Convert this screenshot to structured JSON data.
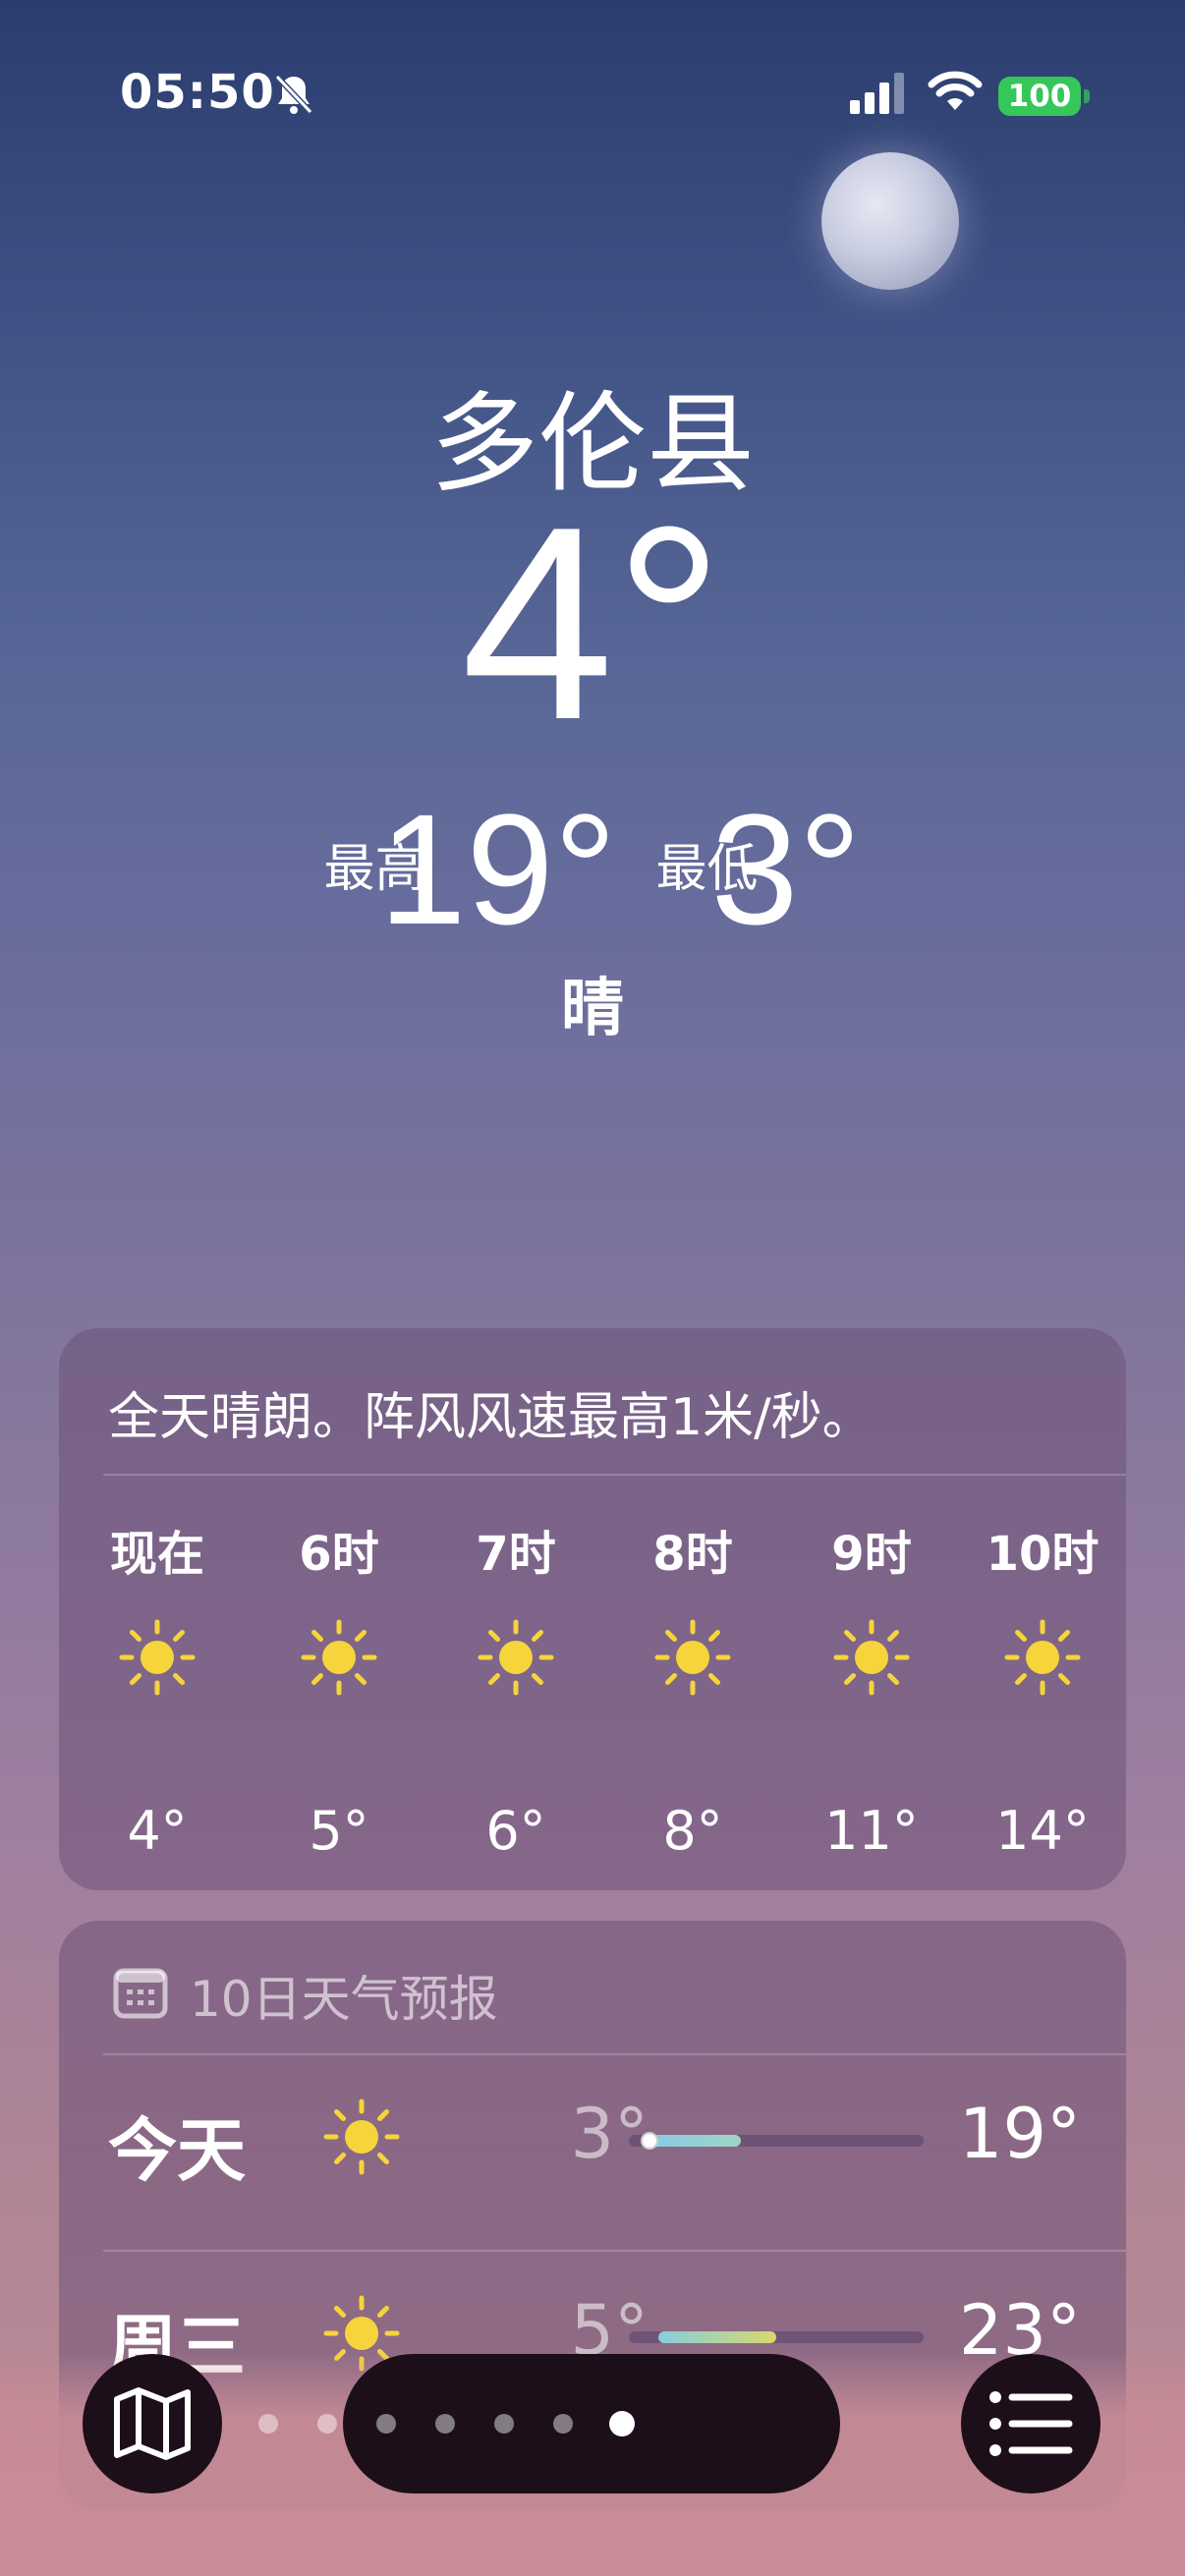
{
  "status_bar": {
    "time": "05:50",
    "battery": "100"
  },
  "location": {
    "city": "多伦县",
    "temperature": "4°",
    "high_label": "最高",
    "high": "19°",
    "low_label": "最低",
    "low": "3°",
    "condition": "晴"
  },
  "hourly": {
    "summary": "全天晴朗。阵风风速最高1米/秒。",
    "hours": [
      {
        "label": "现在",
        "icon": "sun-icon",
        "temp": "4°"
      },
      {
        "label": "6时",
        "icon": "sun-icon",
        "temp": "5°"
      },
      {
        "label": "7时",
        "icon": "sun-icon",
        "temp": "6°"
      },
      {
        "label": "8时",
        "icon": "sun-icon",
        "temp": "8°"
      },
      {
        "label": "9时",
        "icon": "sun-icon",
        "temp": "11°"
      },
      {
        "label": "10时",
        "icon": "sun-icon",
        "temp": "14°"
      }
    ]
  },
  "daily": {
    "title": "10日天气预报",
    "days": [
      {
        "day": "今天",
        "icon": "sun-icon",
        "low": "3°",
        "high": "19°",
        "range_start": 0.05,
        "range_end": 0.38,
        "current_marker": 0.05
      },
      {
        "day": "周三",
        "icon": "sun-icon",
        "low": "5°",
        "high": "23°",
        "range_start": 0.1,
        "range_end": 0.5
      }
    ]
  },
  "pager": {
    "page_count": 7,
    "active_index": 6
  },
  "colors": {
    "sun": "#f6d43b",
    "battery": "#35c759",
    "button_bg": "#1c0f1a"
  }
}
